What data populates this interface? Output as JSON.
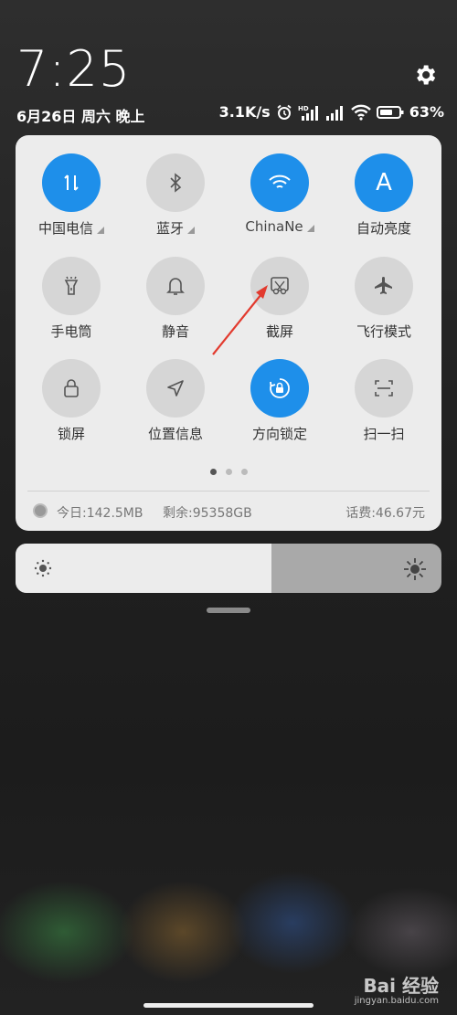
{
  "status_bar": {
    "time": "7:25",
    "date": "6月26日 周六 晚上",
    "net_speed": "3.1K/s",
    "battery": "63%"
  },
  "tiles": [
    {
      "label": "中国电信",
      "icon": "mobile-data-icon",
      "on": true,
      "has_dropdown": true
    },
    {
      "label": "蓝牙",
      "icon": "bluetooth-icon",
      "on": false,
      "has_dropdown": true
    },
    {
      "label": "ChinaNe",
      "icon": "wifi-icon",
      "on": true,
      "has_dropdown": true
    },
    {
      "label": "自动亮度",
      "icon": "auto-brightness-icon",
      "on": true,
      "has_dropdown": false
    },
    {
      "label": "手电筒",
      "icon": "flashlight-icon",
      "on": false
    },
    {
      "label": "静音",
      "icon": "bell-icon",
      "on": false
    },
    {
      "label": "截屏",
      "icon": "screenshot-icon",
      "on": false
    },
    {
      "label": "飞行模式",
      "icon": "airplane-icon",
      "on": false
    },
    {
      "label": "锁屏",
      "icon": "lock-icon",
      "on": false
    },
    {
      "label": "位置信息",
      "icon": "location-icon",
      "on": false
    },
    {
      "label": "方向锁定",
      "icon": "rotation-lock-icon",
      "on": true
    },
    {
      "label": "扫一扫",
      "icon": "scan-icon",
      "on": false
    }
  ],
  "auto_brightness_letter": "A",
  "pager": {
    "pages": 3,
    "active": 0
  },
  "usage": {
    "today": "今日:142.5MB",
    "remaining": "剩余:95358GB",
    "balance": "话费:46.67元"
  },
  "brightness": {
    "level": 0.6
  },
  "watermark": {
    "brand": "Bai 经验",
    "site": "jingyan.baidu.com"
  }
}
